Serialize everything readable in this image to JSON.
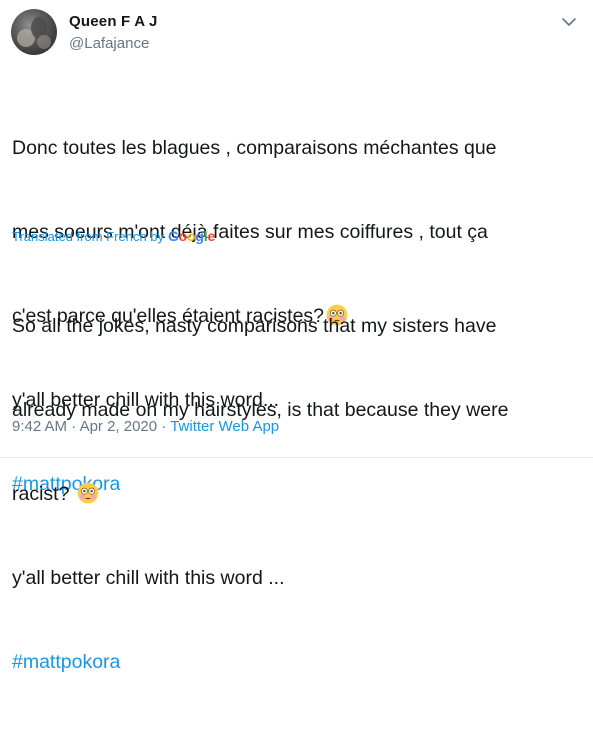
{
  "author": {
    "name": "Queen F A J",
    "handle": "@Lafajance"
  },
  "tweet": {
    "original_lines": [
      "Donc toutes les blagues , comparaisons méchantes que",
      "mes soeurs m'ont déjà faites sur mes coiffures , tout ça",
      "c'est parce qu'elles étaient racistes?",
      "y'all better chill with this word...",
      "#mattpokora"
    ],
    "translated_label": "Translated from French by",
    "translator": "Google",
    "translated_lines": [
      "So all the jokes, nasty comparisons that my sisters have",
      "already made on my hairstyles, is that because they were",
      "racist? ",
      " y'all better chill with this word ...",
      "#mattpokora"
    ],
    "emoji_name": "flushed-face-emoji"
  },
  "footer": {
    "time": "9:42 AM",
    "date": "Apr 2, 2020",
    "separator": "·",
    "app": "Twitter Web App"
  },
  "colors": {
    "link": "#1b95e0",
    "secondary_text": "#657786",
    "text": "#14171a",
    "google_blue": "#4285f4",
    "google_red": "#ea4335",
    "google_yellow": "#fbbc05",
    "google_green": "#34a853"
  },
  "icons": {
    "more": "chevron-down-icon"
  }
}
